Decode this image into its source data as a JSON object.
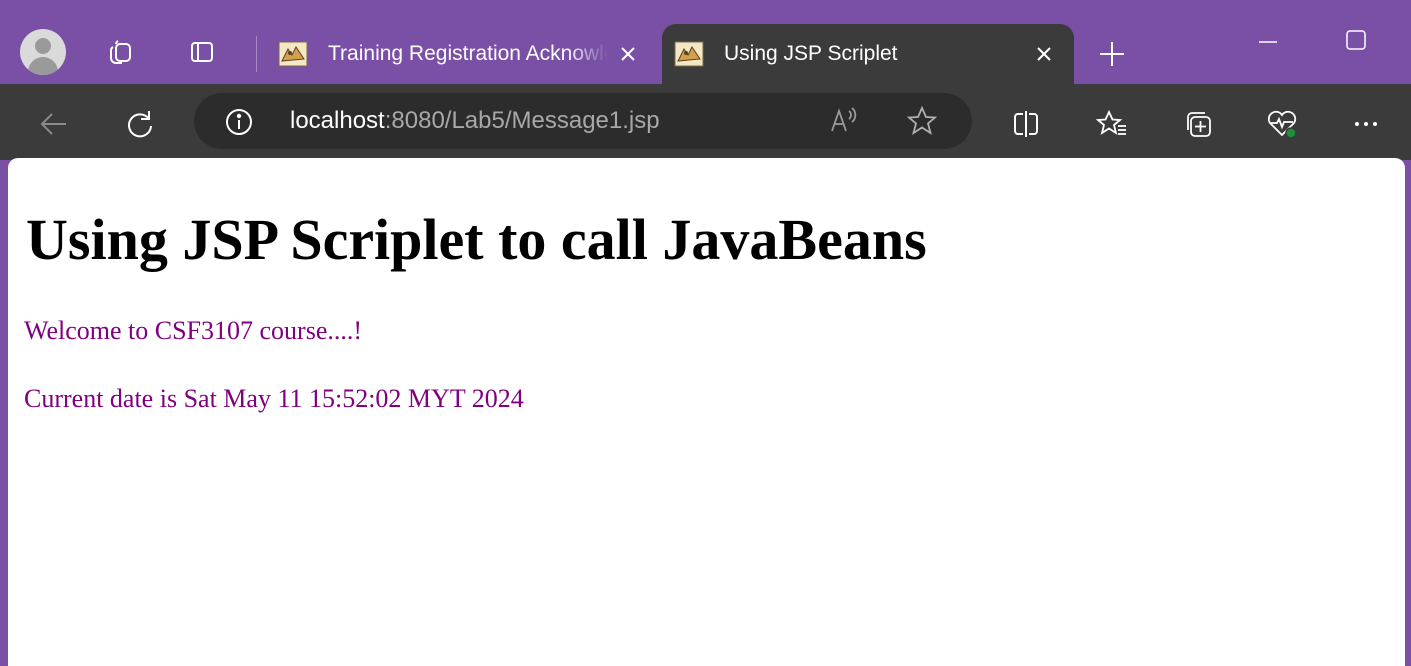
{
  "browser": {
    "tabs": [
      {
        "title": "Training Registration Acknowledgement",
        "active": false,
        "favicon": "tomcat-icon"
      },
      {
        "title": "Using JSP Scriplet",
        "active": true,
        "favicon": "tomcat-icon"
      }
    ],
    "address": {
      "host": "localhost",
      "rest": ":8080/Lab5/Message1.jsp"
    },
    "icons": {
      "profile": "profile-avatar-icon",
      "workspaces": "workspaces-icon",
      "tab_actions": "tab-actions-icon",
      "new_tab": "plus-icon",
      "minimize": "minimize-icon",
      "maximize": "maximize-icon",
      "back": "back-arrow-icon",
      "refresh": "refresh-icon",
      "site_info": "info-icon",
      "read_aloud": "read-aloud-icon",
      "favorite": "star-icon",
      "split_screen": "split-screen-icon",
      "favorites": "favorites-icon",
      "collections": "collections-icon",
      "browser_essentials": "heart-pulse-icon",
      "more": "more-icon"
    },
    "colors": {
      "tabstrip": "#7a4fa6",
      "toolbar": "#3b3b3b",
      "addressbar": "#2c2c2c",
      "status_dot": "#1e8e3e"
    }
  },
  "page": {
    "heading": "Using JSP Scriplet to call JavaBeans",
    "welcome": "Welcome to CSF3107 course....!",
    "date_line": "Current date is Sat May 11 15:52:02 MYT 2024",
    "text_color": "#800080"
  }
}
